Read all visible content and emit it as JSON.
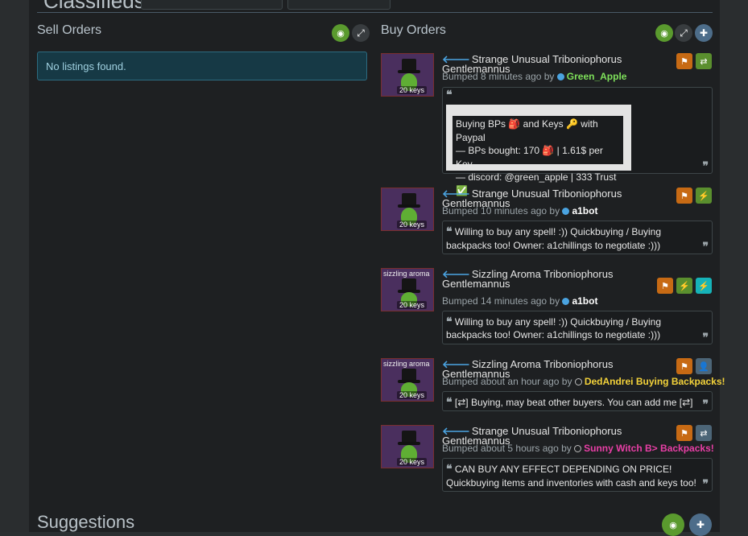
{
  "top": {
    "title": "Classifieds"
  },
  "sell": {
    "title": "Sell Orders",
    "empty": "No listings found."
  },
  "buy": {
    "title": "Buy Orders"
  },
  "listings": [
    {
      "title": "Strange Unusual Triboniophorus Gentlemannus",
      "bumped": "Bumped 8 minutes ago by",
      "user": "Green_Apple",
      "user_color": "#7ee05a",
      "keys": "20 keys",
      "effect": "",
      "desc_lines": [
        "Buying BPs 🎒 and Keys 🔑 with Paypal",
        "— BPs bought: 170 🎒 | 1.61$ per Key",
        "— discord: @green_apple | 333 Trust ✅"
      ]
    },
    {
      "title": "Strange Unusual Triboniophorus Gentlemannus",
      "bumped": "Bumped 10 minutes ago by",
      "user": "a1bot",
      "user_color": "#ffffff",
      "keys": "20 keys",
      "effect": "",
      "desc": "Willing to buy any spell! :)) Quickbuying / Buying backpacks too!         Owner: a1chillings         to negotiate :)))"
    },
    {
      "title": "Sizzling Aroma Triboniophorus Gentlemannus",
      "bumped": "Bumped 14 minutes ago by",
      "user": "a1bot",
      "user_color": "#ffffff",
      "keys": "20 keys",
      "effect": "sizzling aroma",
      "desc": "Willing to buy any spell! :)) Quickbuying / Buying backpacks too!         Owner: a1chillings         to negotiate :)))"
    },
    {
      "title": "Sizzling Aroma Triboniophorus Gentlemannus",
      "bumped": "Bumped about an hour ago by",
      "user": "DedAndrei Buying Backpacks!",
      "user_color": "#f3d23a",
      "keys": "20 keys",
      "effect": "sizzling aroma",
      "desc": "[⇄] Buying, may beat other buyers. You can add me [⇄]"
    },
    {
      "title": "Strange Unusual Triboniophorus Gentlemannus",
      "bumped": "Bumped about 5 hours ago by",
      "user": "Sunny Witch B> Backpacks!",
      "user_color": "#e83fa6",
      "keys": "20 keys",
      "effect": "",
      "desc": "CAN BUY ANY EFFECT DEPENDING ON PRICE! Quickbuying items and inventories with cash and keys too!"
    }
  ],
  "suggestions": {
    "title": "Suggestions"
  },
  "icons": [
    "eye-slash-icon",
    "expand-icon",
    "plus-icon",
    "flag-icon",
    "exchange-icon",
    "bolt-icon",
    "user-plus-icon",
    "key-icon",
    "quote-icon"
  ]
}
